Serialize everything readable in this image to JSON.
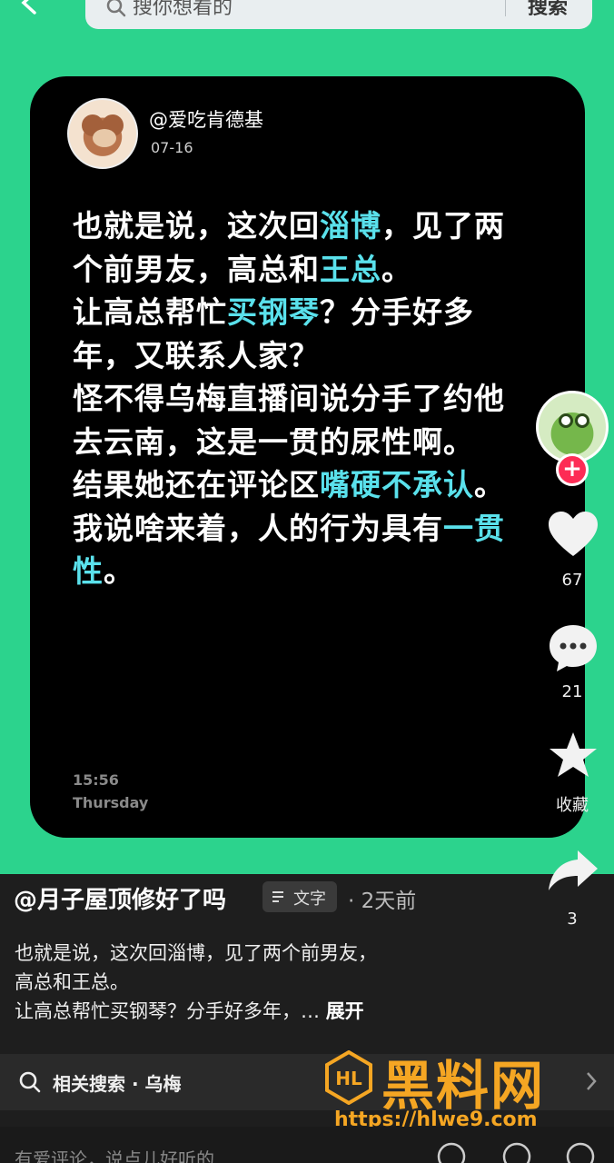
{
  "search": {
    "placeholder": "搜你想看的",
    "button": "搜索"
  },
  "card": {
    "author": "@爱吃肯德基",
    "date": "07-16",
    "segments": [
      {
        "text": "也就是说，这次回",
        "hl": false
      },
      {
        "text": "淄博",
        "hl": true
      },
      {
        "text": "，见了两个前男友，高总和",
        "hl": false
      },
      {
        "text": "王总",
        "hl": true
      },
      {
        "text": "。\n让高总帮忙",
        "hl": false
      },
      {
        "text": "买钢琴",
        "hl": true
      },
      {
        "text": "？分手好多年，又联系人家？\n怪不得乌梅直播间说分手了约他去云南，这是一贯的尿性啊。\n结果她还在评论区",
        "hl": false
      },
      {
        "text": "嘴硬不承认",
        "hl": true
      },
      {
        "text": "。\n我说啥来着，人的行为具有",
        "hl": false
      },
      {
        "text": "一贯性",
        "hl": true
      },
      {
        "text": "。",
        "hl": false
      }
    ],
    "time": "15:56",
    "day": "Thursday"
  },
  "rail": {
    "likes": "67",
    "comments": "21",
    "favorite_label": "收藏",
    "shares": "3",
    "follow": "+"
  },
  "info": {
    "username": "@月子屋顶修好了吗",
    "tag": "文字",
    "time": "· 2天前",
    "desc_lines": [
      "也就是说，这次回淄博，见了两个前男友，",
      "高总和王总。",
      "让高总帮忙买钢琴？分手好多年，… "
    ],
    "expand": "展开"
  },
  "related": {
    "text": "相关搜索 · 乌梅"
  },
  "watermark": {
    "title": "黑料网",
    "url": "https://hlwe9.com"
  },
  "comment": {
    "placeholder": "有爱评论，说点儿好听的"
  },
  "colors": {
    "green": "#2cd38d",
    "highlight": "#5ae1ec",
    "follow": "#fd2c55",
    "watermark": "#f5a623"
  }
}
